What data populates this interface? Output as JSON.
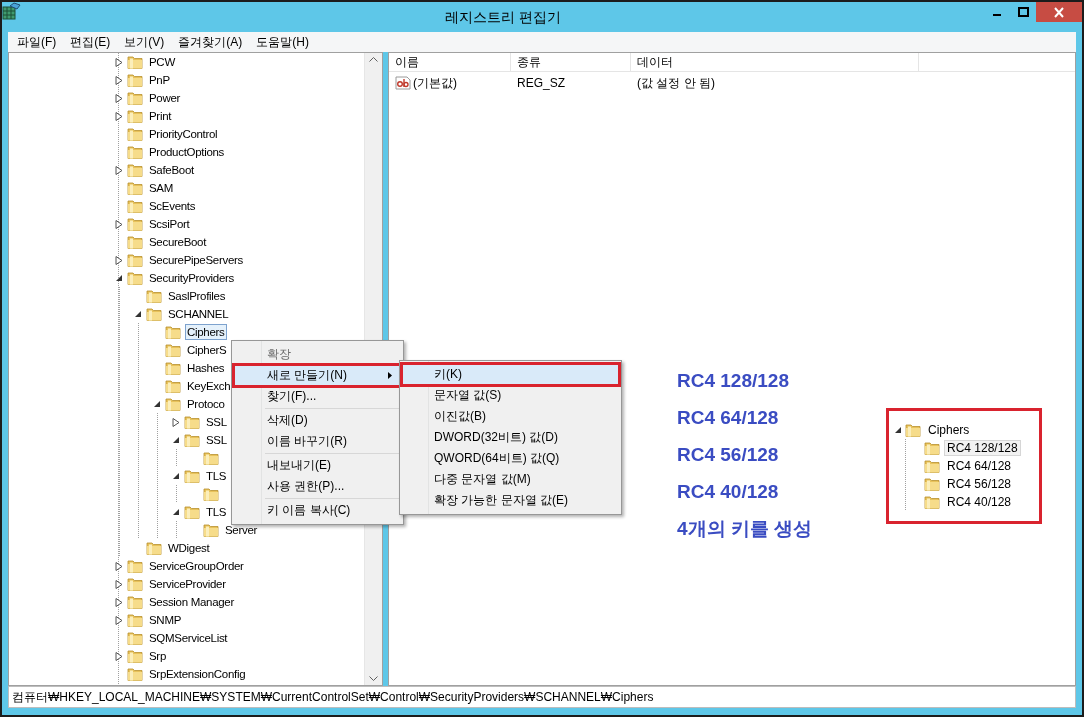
{
  "window": {
    "title": "레지스트리 편집기"
  },
  "menu_bar": [
    "파일(F)",
    "편집(E)",
    "보기(V)",
    "즐겨찾기(A)",
    "도움말(H)"
  ],
  "tree": {
    "items": [
      {
        "label": "PCW",
        "expanded": false,
        "selected": false
      },
      {
        "label": "PnP",
        "expanded": false,
        "selected": false
      },
      {
        "label": "Power",
        "expanded": false,
        "selected": false
      },
      {
        "label": "Print",
        "expanded": false,
        "selected": false
      },
      {
        "label": "PriorityControl",
        "selected": false
      },
      {
        "label": "ProductOptions",
        "selected": false
      },
      {
        "label": "SafeBoot",
        "expanded": false,
        "selected": false
      },
      {
        "label": "SAM",
        "selected": false
      },
      {
        "label": "ScEvents",
        "selected": false
      },
      {
        "label": "ScsiPort",
        "expanded": false,
        "selected": false
      },
      {
        "label": "SecureBoot",
        "selected": false
      },
      {
        "label": "SecurePipeServers",
        "expanded": false,
        "selected": false
      },
      {
        "label": "SecurityProviders",
        "expanded": true,
        "selected": false,
        "children": [
          {
            "label": "SaslProfiles",
            "selected": false
          },
          {
            "label": "SCHANNEL",
            "expanded": true,
            "selected": false,
            "children": [
              {
                "label": "Ciphers",
                "selected": true
              },
              {
                "label": "CipherS",
                "selected": false
              },
              {
                "label": "Hashes",
                "selected": false
              },
              {
                "label": "KeyExch",
                "selected": false
              },
              {
                "label": "Protoco",
                "expanded": true,
                "selected": false,
                "children": [
                  {
                    "label": "SSL",
                    "expanded": false,
                    "selected": false
                  },
                  {
                    "label": "SSL",
                    "expanded": true,
                    "selected": false,
                    "children": [
                      {
                        "selected": false
                      }
                    ]
                  },
                  {
                    "label": "TLS",
                    "expanded": true,
                    "selected": false,
                    "children": [
                      {
                        "selected": false
                      }
                    ]
                  },
                  {
                    "label": "TLS",
                    "expanded": true,
                    "selected": false,
                    "children": [
                      {
                        "label": "Server",
                        "selected": false
                      }
                    ]
                  }
                ]
              }
            ]
          },
          {
            "label": "WDigest",
            "selected": false
          }
        ]
      },
      {
        "label": "ServiceGroupOrder",
        "expanded": false,
        "selected": false
      },
      {
        "label": "ServiceProvider",
        "expanded": false,
        "selected": false
      },
      {
        "label": "Session Manager",
        "expanded": false,
        "selected": false
      },
      {
        "label": "SNMP",
        "expanded": false,
        "selected": false
      },
      {
        "label": "SQMServiceList",
        "selected": false
      },
      {
        "label": "Srp",
        "expanded": false,
        "selected": false
      },
      {
        "label": "SrpExtensionConfig",
        "selected": false
      }
    ]
  },
  "list": {
    "columns": [
      "이름",
      "종류",
      "데이터"
    ],
    "rows": [
      {
        "name": "(기본값)",
        "type": "REG_SZ",
        "data": "(값 설정 안 됨)"
      }
    ]
  },
  "context_menu": {
    "items": [
      {
        "kind": "item",
        "label": "확장",
        "disabled": true,
        "highlighted": false,
        "outlined": false,
        "submenu": false
      },
      {
        "kind": "item",
        "label": "새로 만들기(N)",
        "disabled": false,
        "highlighted": true,
        "outlined": true,
        "submenu": true
      },
      {
        "kind": "item",
        "label": "찾기(F)...",
        "disabled": false,
        "highlighted": false,
        "outlined": false,
        "submenu": false
      },
      {
        "kind": "separator"
      },
      {
        "kind": "item",
        "label": "삭제(D)",
        "disabled": false,
        "highlighted": false,
        "outlined": false,
        "submenu": false
      },
      {
        "kind": "item",
        "label": "이름 바꾸기(R)",
        "disabled": false,
        "highlighted": false,
        "outlined": false,
        "submenu": false
      },
      {
        "kind": "separator"
      },
      {
        "kind": "item",
        "label": "내보내기(E)",
        "disabled": false,
        "highlighted": false,
        "outlined": false,
        "submenu": false
      },
      {
        "kind": "item",
        "label": "사용 권한(P)...",
        "disabled": false,
        "highlighted": false,
        "outlined": false,
        "submenu": false
      },
      {
        "kind": "separator"
      },
      {
        "kind": "item",
        "label": "키 이름 복사(C)",
        "disabled": false,
        "highlighted": false,
        "outlined": false,
        "submenu": false
      }
    ]
  },
  "submenu": {
    "items": [
      {
        "kind": "item",
        "label": "키(K)",
        "highlighted": true,
        "outlined": true
      },
      {
        "kind": "item",
        "label": "문자열 값(S)",
        "highlighted": false,
        "outlined": false
      },
      {
        "kind": "item",
        "label": "이진값(B)",
        "highlighted": false,
        "outlined": false
      },
      {
        "kind": "item",
        "label": "DWORD(32비트) 값(D)",
        "highlighted": false,
        "outlined": false
      },
      {
        "kind": "item",
        "label": "QWORD(64비트) 값(Q)",
        "highlighted": false,
        "outlined": false
      },
      {
        "kind": "item",
        "label": "다중 문자열 값(M)",
        "highlighted": false,
        "outlined": false
      },
      {
        "kind": "item",
        "label": "확장 가능한 문자열 값(E)",
        "highlighted": false,
        "outlined": false
      }
    ]
  },
  "annotation": {
    "lines": [
      "RC4 128/128",
      "RC4 64/128",
      "RC4 56/128",
      "RC4 40/128",
      "4개의 키를 생성"
    ]
  },
  "inset_tree": {
    "label": "Ciphers",
    "expanded": true,
    "children": [
      {
        "label": "RC4 128/128",
        "selected": true
      },
      {
        "label": "RC4 64/128",
        "selected": false
      },
      {
        "label": "RC4 56/128",
        "selected": false
      },
      {
        "label": "RC4 40/128",
        "selected": false
      }
    ]
  },
  "status_bar": "컴퓨터₩HKEY_LOCAL_MACHINE₩SYSTEM₩CurrentControlSet₩Control₩SecurityProviders₩SCHANNEL₩Ciphers"
}
